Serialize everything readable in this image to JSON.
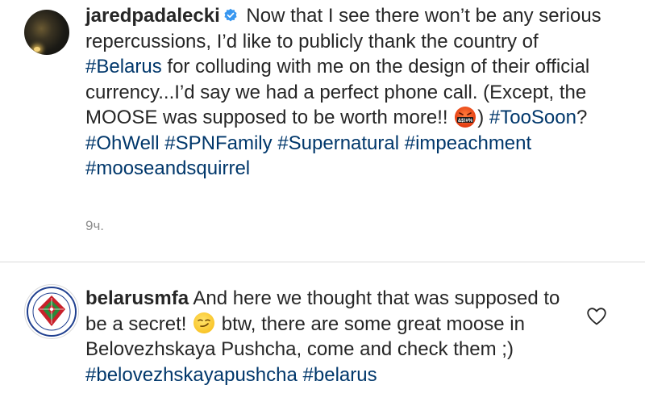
{
  "comment1": {
    "username": "jaredpadalecki",
    "verified": true,
    "text_before_emoji": " Now that I see there won’t be any serious repercussions, I’d like to publicly thank the country of ",
    "tag_belarus": "#Belarus",
    "text_mid": " for colluding with me on the design of their official currency...I’d say we had a perfect phone call. (Except, the MOOSE was supposed to be worth more!! ",
    "emoji_label": "&$!#%",
    "text_after_emoji": ") ",
    "hashtags": [
      "#TooSoon",
      "#OhWell",
      "#SPNFamily",
      "#Supernatural",
      "#impeachment",
      "#mooseandsquirrel"
    ],
    "question_mark": "?",
    "time": "9ч."
  },
  "comment2": {
    "username": "belarusmfa",
    "text_before_emoji": " And here we thought that was supposed to be a secret! ",
    "emoji": "smirk",
    "text_after_emoji": " btw, there are some great moose in Belovezhskaya Pushcha, come and check them ;)",
    "hashtags": [
      "#belovezhskayapushcha",
      "#belarus"
    ],
    "like_icon": "heart-outline-icon"
  },
  "colors": {
    "text": "#262626",
    "hashtag": "#00376b",
    "meta": "#8e8e8e",
    "verified": "#3897f0",
    "divider": "#dbdbdb"
  }
}
